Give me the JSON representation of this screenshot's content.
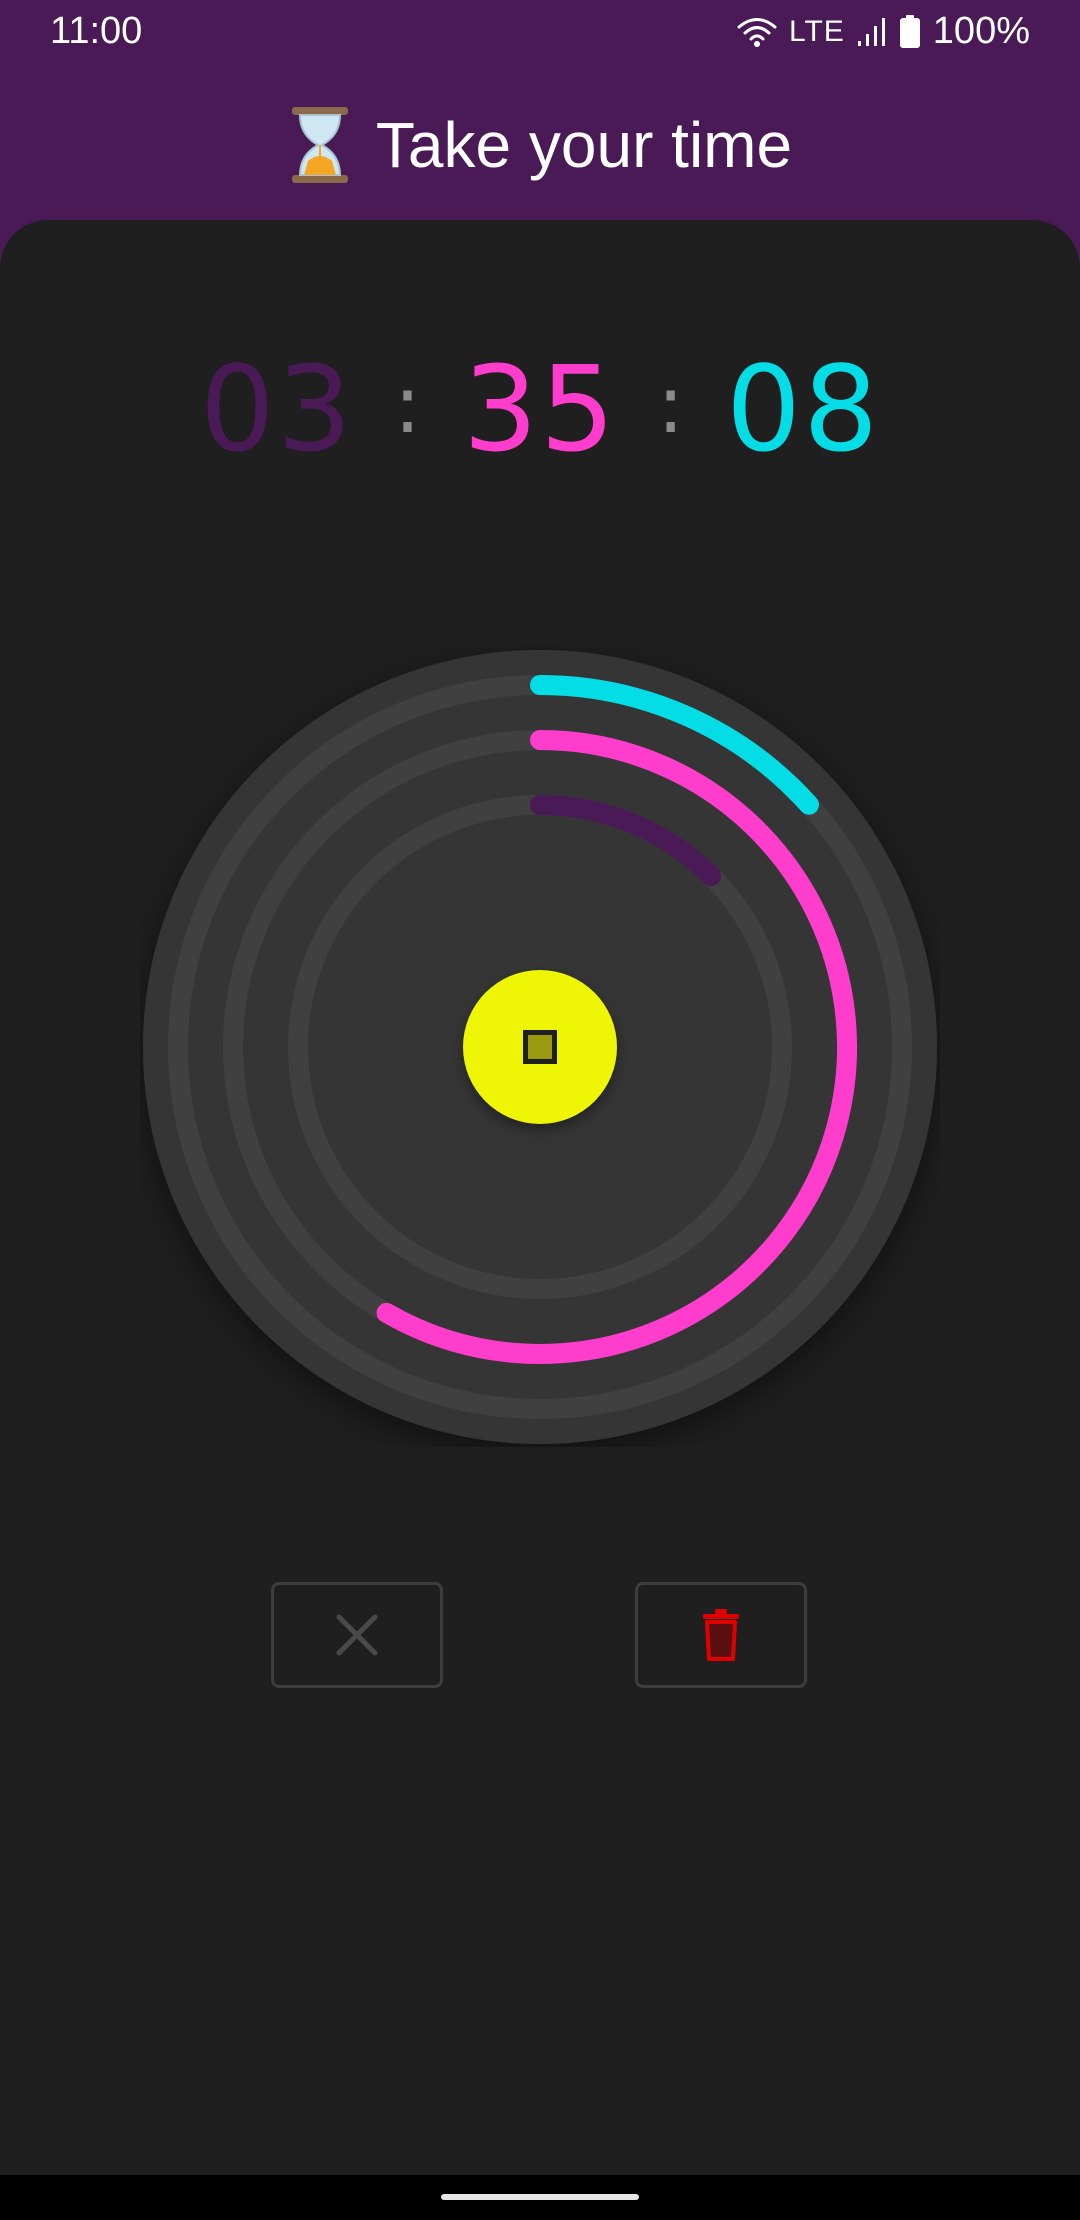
{
  "status_bar": {
    "time": "11:00",
    "network": "LTE",
    "battery": "100%",
    "icons": [
      "wifi-icon",
      "signal-icon",
      "battery-icon"
    ]
  },
  "header": {
    "title": "Take your time",
    "icon": "hourglass-icon"
  },
  "timer": {
    "hours": "03",
    "minutes": "35",
    "seconds": "08",
    "separator": ":"
  },
  "colors": {
    "header_bg": "#4a1a57",
    "panel_bg": "#1f1f1f",
    "hours": "#4a1a57",
    "minutes": "#ff3dcc",
    "seconds": "#05dde6",
    "stop_button": "#eef505",
    "delete": "#e00000",
    "cancel": "#4a4a4a"
  },
  "rings": {
    "seconds_progress": 0.1333,
    "minutes_progress": 0.5833,
    "hours_progress": 0.125
  },
  "buttons": {
    "stop": "stop-icon",
    "cancel": "close-icon",
    "delete": "trash-icon"
  }
}
